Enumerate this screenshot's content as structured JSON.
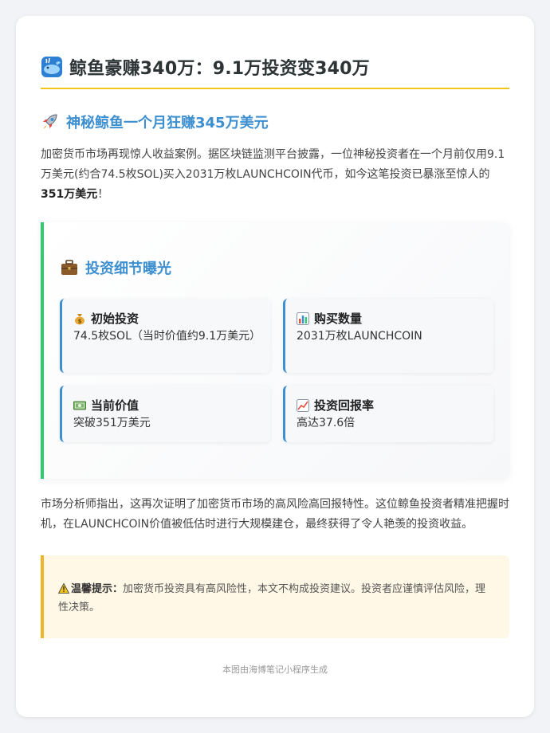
{
  "title": "鲸鱼豪赚340万：9.1万投资变340万",
  "section": {
    "title": "神秘鲸鱼一个月狂赚345万美元",
    "paragraph_pre": "加密货币市场再现惊人收益案例。据区块链监测平台披露，一位神秘投资者在一个月前仅用9.1万美元(约合74.5枚SOL)买入2031万枚LAUNCHCOIN代币，如今这笔投资已暴涨至惊人的",
    "paragraph_bold": "351万美元",
    "paragraph_post": "！"
  },
  "details": {
    "title": "投资细节曝光",
    "items": [
      {
        "label": "初始投资",
        "value": "74.5枚SOL（当时价值约9.1万美元）",
        "icon": "money-bag-icon"
      },
      {
        "label": "购买数量",
        "value": "2031万枚LAUNCHCOIN",
        "icon": "bar-chart-icon"
      },
      {
        "label": "当前价值",
        "value": "突破351万美元",
        "icon": "banknote-icon"
      },
      {
        "label": "投资回报率",
        "value": "高达37.6倍",
        "icon": "trend-up-icon"
      }
    ]
  },
  "analysis": "市场分析师指出，这再次证明了加密货币市场的高风险高回报特性。这位鲸鱼投资者精准把握时机，在LAUNCHCOIN价值被低估时进行大规模建仓，最终获得了令人艳羡的投资收益。",
  "tip": {
    "label": "温馨提示：",
    "text": "加密货币投资具有高风险性，本文不构成投资建议。投资者应谨慎评估风险，理性决策。"
  },
  "footer": "本图由海博笔记小程序生成",
  "colors": {
    "accent_blue": "#3d8fd0",
    "title_underline": "#f0c419",
    "detail_border": "#2ecc71",
    "tip_border": "#f0b429",
    "tip_background": "#fff8e6"
  }
}
